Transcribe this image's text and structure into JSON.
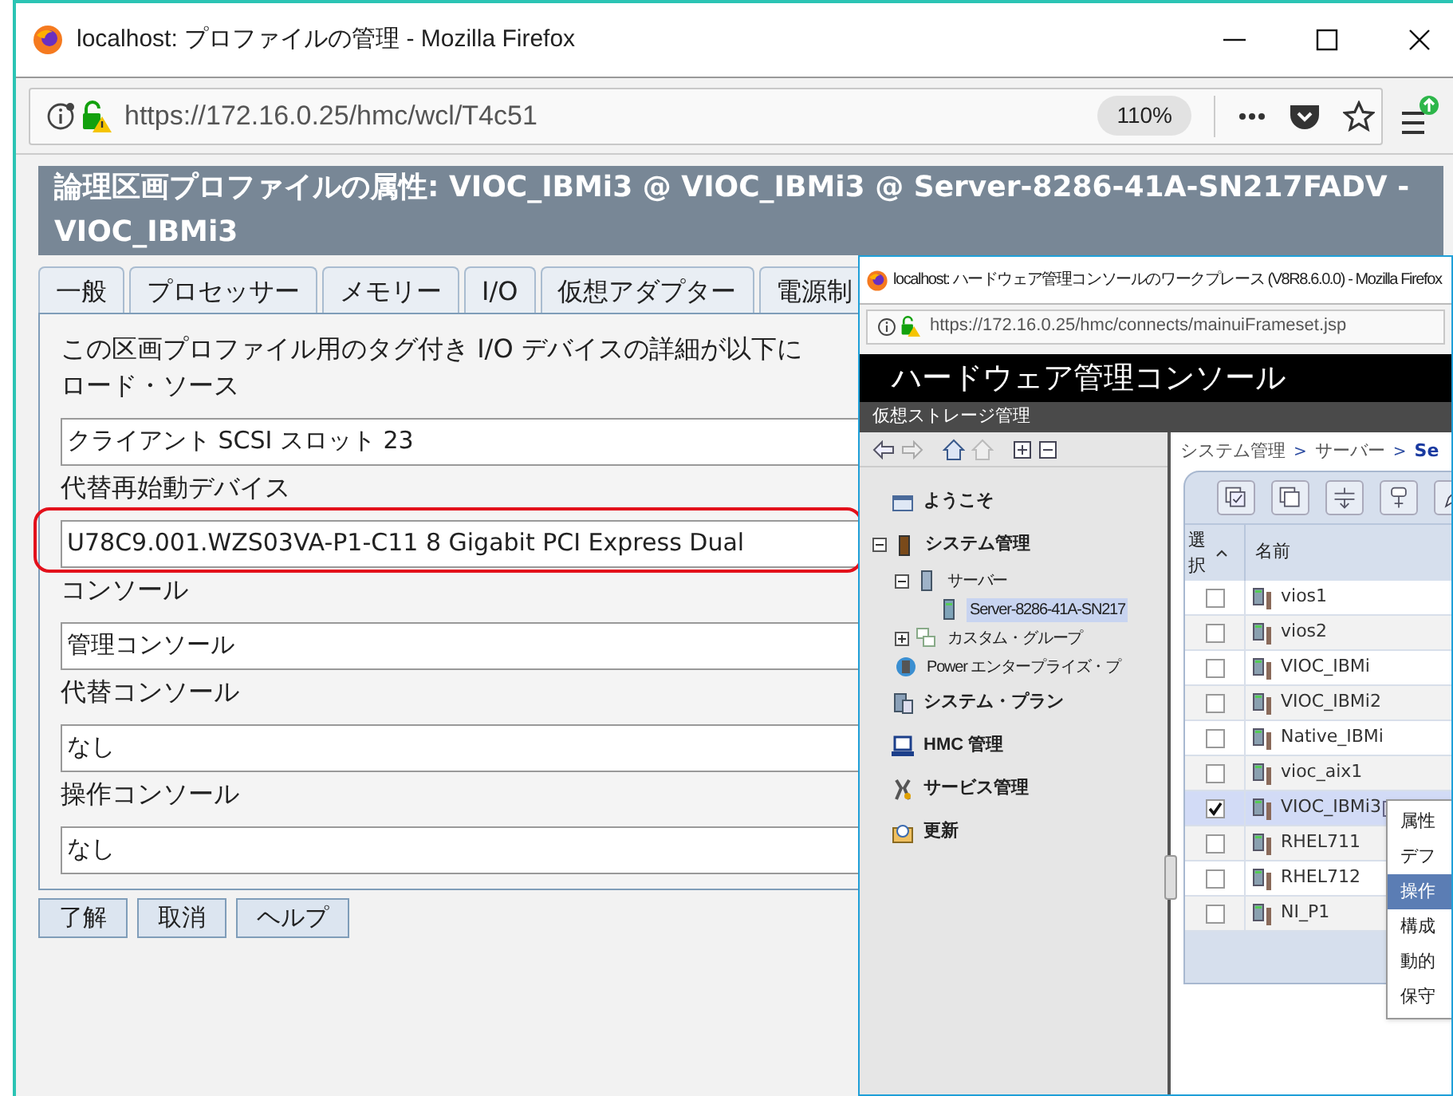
{
  "window": {
    "title": "localhost: プロファイルの管理 - Mozilla Firefox"
  },
  "address_bar": {
    "url": "https://172.16.0.25/hmc/wcl/T4c51",
    "zoom": "110%"
  },
  "dialog": {
    "title": "論理区画プロファイルの属性: VIOC_IBMi3 @ VIOC_IBMi3 @ Server-8286-41A-SN217FADV - VIOC_IBMi3",
    "tabs": [
      "一般",
      "プロセッサー",
      "メモリー",
      "I/O",
      "仮想アダプター",
      "電源制"
    ],
    "description": "この区画プロファイル用のタグ付き I/O デバイスの詳細が以下に",
    "fields": [
      {
        "label": "ロード・ソース",
        "value": "クライアント SCSI スロット 23"
      },
      {
        "label": "代替再始動デバイス",
        "value": "U78C9.001.WZS03VA-P1-C11 8 Gigabit PCI Express Dual"
      },
      {
        "label": "コンソール",
        "value": "管理コンソール"
      },
      {
        "label": "代替コンソール",
        "value": "なし"
      },
      {
        "label": "操作コンソール",
        "value": "なし"
      }
    ],
    "buttons": [
      "了解",
      "取消",
      "ヘルプ"
    ]
  },
  "second_window": {
    "title": "localhost: ハードウェア管理コンソールのワークプレース (V8R8.6.0.0) - Mozilla Firefox",
    "url": "https://172.16.0.25/hmc/connects/mainuiFrameset.jsp",
    "app_title": "ハードウェア管理コンソール",
    "task_bar": "仮想ストレージ管理",
    "nav": [
      {
        "label": "ようこそ",
        "kind": "welcome",
        "selected": false
      },
      {
        "label": "システム管理",
        "kind": "systems",
        "selected": false,
        "expanded": true,
        "children": [
          {
            "label": "サーバー",
            "kind": "servers",
            "selected": false,
            "expanded": true,
            "children": [
              {
                "label": "Server-8286-41A-SN217",
                "kind": "server",
                "selected": true
              }
            ]
          },
          {
            "label": "カスタム・グループ",
            "kind": "groups",
            "selected": false,
            "expanded": false
          },
          {
            "label": "Power エンタープライズ・プ",
            "kind": "pool",
            "selected": false
          }
        ]
      },
      {
        "label": "システム・プラン",
        "kind": "plans",
        "selected": false
      },
      {
        "label": "HMC 管理",
        "kind": "hmc",
        "selected": false
      },
      {
        "label": "サービス管理",
        "kind": "service",
        "selected": false
      },
      {
        "label": "更新",
        "kind": "update",
        "selected": false
      }
    ],
    "breadcrumb": [
      {
        "kind": "link",
        "text": "システム管理"
      },
      {
        "kind": "separator",
        "text": ">"
      },
      {
        "kind": "link",
        "text": "サーバー"
      },
      {
        "kind": "separator",
        "text": ">"
      },
      {
        "kind": "current",
        "text": "Se"
      }
    ],
    "table": {
      "columns": [
        "選択",
        "名前"
      ],
      "rows": [
        {
          "name": "vios1",
          "checked": false,
          "selected": false
        },
        {
          "name": "vios2",
          "checked": false,
          "selected": false
        },
        {
          "name": "VIOC_IBMi",
          "checked": false,
          "selected": false
        },
        {
          "name": "VIOC_IBMi2",
          "checked": false,
          "selected": false
        },
        {
          "name": "Native_IBMi",
          "checked": false,
          "selected": false
        },
        {
          "name": "vioc_aix1",
          "checked": false,
          "selected": false
        },
        {
          "name": "VIOC_IBMi3",
          "checked": true,
          "selected": true
        },
        {
          "name": "RHEL711",
          "checked": false,
          "selected": false
        },
        {
          "name": "RHEL712",
          "checked": false,
          "selected": false
        },
        {
          "name": "NI_P1",
          "checked": false,
          "selected": false
        }
      ]
    },
    "context_menu": [
      {
        "label": "属性",
        "selected": false
      },
      {
        "label": "デフ",
        "selected": false
      },
      {
        "label": "操作",
        "selected": true
      },
      {
        "label": "構成",
        "selected": false
      },
      {
        "label": "動的",
        "selected": false
      },
      {
        "label": "保守",
        "selected": false
      }
    ]
  }
}
